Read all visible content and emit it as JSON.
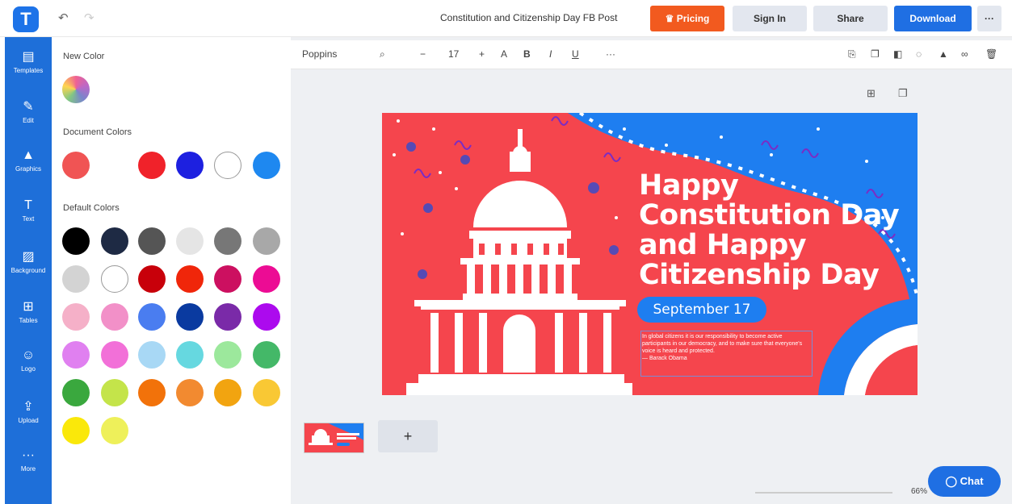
{
  "header": {
    "logo_letter": "T",
    "undo_icon": "undo-icon",
    "redo_icon": "redo-icon",
    "doc_title": "Constitution and Citizenship Day FB Post",
    "pricing_label": "Pricing",
    "signin_label": "Sign In",
    "share_label": "Share",
    "download_label": "Download",
    "more_label": "···"
  },
  "leftnav": [
    {
      "label": "Templates",
      "icon": "▤"
    },
    {
      "label": "Edit",
      "icon": "✎"
    },
    {
      "label": "Graphics",
      "icon": "▲"
    },
    {
      "label": "Text",
      "icon": "T"
    },
    {
      "label": "Background",
      "icon": "▨"
    },
    {
      "label": "Tables",
      "icon": "⊞"
    },
    {
      "label": "Logo",
      "icon": "☺"
    },
    {
      "label": "Upload",
      "icon": "⇪"
    },
    {
      "label": "More",
      "icon": "···"
    }
  ],
  "color_panel": {
    "new_color_heading": "New Color",
    "document_colors_heading": "Document Colors",
    "default_colors_heading": "Default Colors",
    "document_colors": [
      "#f05454",
      "#ffffff",
      "#f0222a",
      "#1d20e0",
      "#ffffff",
      "#1e88f0"
    ],
    "default_colors": [
      "#000000",
      "#1e2a44",
      "#555555",
      "#e5e5e5",
      "#777777",
      "#a8a8a8",
      "#d3d3d3",
      "#ffffff",
      "#c8000a",
      "#f0260a",
      "#cc1060",
      "#ec0c94",
      "#f5b0c8",
      "#f290c8",
      "#4a7df0",
      "#0a3aa0",
      "#7a2aa8",
      "#ac0aee",
      "#e080f0",
      "#f270d8",
      "#a8d8f5",
      "#66d8e0",
      "#9ce89c",
      "#44b868",
      "#3aa83e",
      "#c4e44a",
      "#f2720a",
      "#f28a30",
      "#f2a410",
      "#f9c834",
      "#fae80a",
      "#eef05a"
    ]
  },
  "format_bar": {
    "font_name": "Poppins",
    "font_size": "17",
    "decrease": "−",
    "increase": "+",
    "bold": "B",
    "italic": "I",
    "underline": "U",
    "more": "···"
  },
  "design": {
    "heading": "Happy Constitution Day and Happy Citizenship Day",
    "date_pill": "September 17",
    "body": "In global citizens it is our responsibility to become active participants in our democracy, and to make sure that everyone's voice is heard and protected.",
    "attribution": "— Barack Obama",
    "colors": {
      "background": "#f5454d",
      "blue": "#1e7ef0",
      "white": "#ffffff"
    }
  },
  "pages": {
    "add_label": "+"
  },
  "footer": {
    "zoom": "66%",
    "chat_label": "Chat"
  }
}
